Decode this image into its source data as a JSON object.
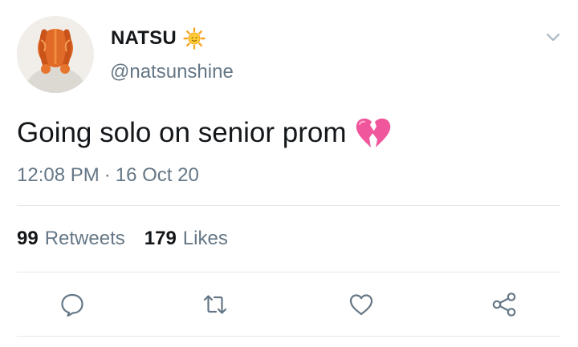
{
  "user": {
    "display_name": "NATSU",
    "handle": "@natsunshine",
    "name_emoji_icon": "sun-emoji-icon"
  },
  "tweet": {
    "text": "Going solo on senior prom",
    "emoji_icon": "broken-heart-emoji-icon",
    "time": "12:08 PM",
    "separator": "·",
    "date": "16 Oct 20"
  },
  "stats": {
    "retweets_count": "99",
    "retweets_label": "Retweets",
    "likes_count": "179",
    "likes_label": "Likes"
  },
  "actions": [
    "reply-icon",
    "retweet-icon",
    "like-icon",
    "share-icon"
  ],
  "colors": {
    "text_primary": "#14171a",
    "text_secondary": "#657786",
    "divider": "#e1e8ed",
    "hair": "#e8752e",
    "heart": "#f0569c"
  }
}
